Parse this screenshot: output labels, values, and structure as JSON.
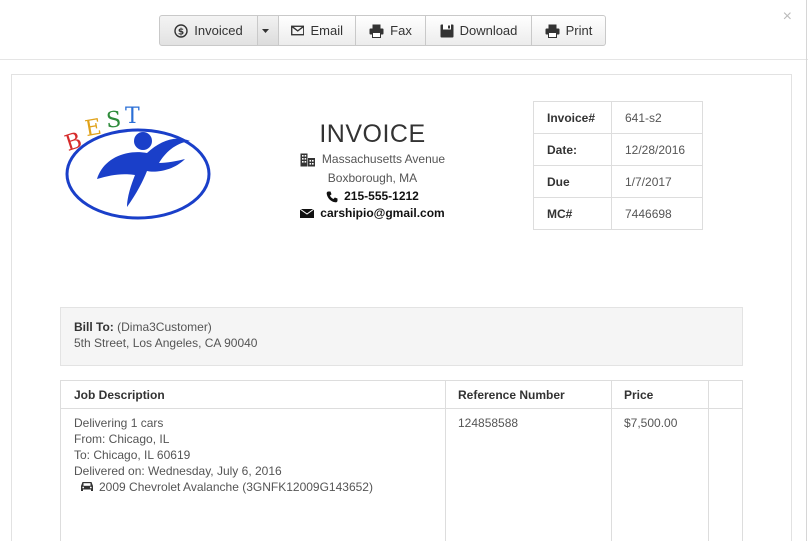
{
  "window": {
    "close_label": "×"
  },
  "toolbar": {
    "invoiced_label": "Invoiced",
    "email_label": "Email",
    "fax_label": "Fax",
    "download_label": "Download",
    "print_label": "Print"
  },
  "logo": {
    "text": "BEST"
  },
  "invoice": {
    "title": "INVOICE",
    "street": "Massachusetts Avenue",
    "city": "Boxborough, MA",
    "phone": "215-555-1212",
    "email": "carshipio@gmail.com"
  },
  "meta": [
    {
      "key": "Invoice#",
      "value": "641-s2"
    },
    {
      "key": "Date:",
      "value": "12/28/2016"
    },
    {
      "key": "Due",
      "value": "1/7/2017"
    },
    {
      "key": "MC#",
      "value": "7446698"
    }
  ],
  "bill_to": {
    "label": "Bill To:",
    "name": "(Dima3Customer)",
    "address": "5th Street, Los Angeles, CA 90040"
  },
  "jobs": {
    "headers": {
      "description": "Job Description",
      "reference": "Reference Number",
      "price": "Price"
    },
    "rows": [
      {
        "line1": "Delivering 1 cars",
        "from": "From: Chicago, IL",
        "to": "To: Chicago, IL 60619",
        "delivered": "Delivered on: Wednesday, July 6, 2016",
        "vehicle": "2009 Chevrolet Avalanche (3GNFK12009G143652)",
        "reference": "124858588",
        "price": "$7,500.00"
      }
    ]
  },
  "colors": {
    "logo_blue": "#1a3fc9",
    "toolbar_border": "#c9c9c9"
  }
}
